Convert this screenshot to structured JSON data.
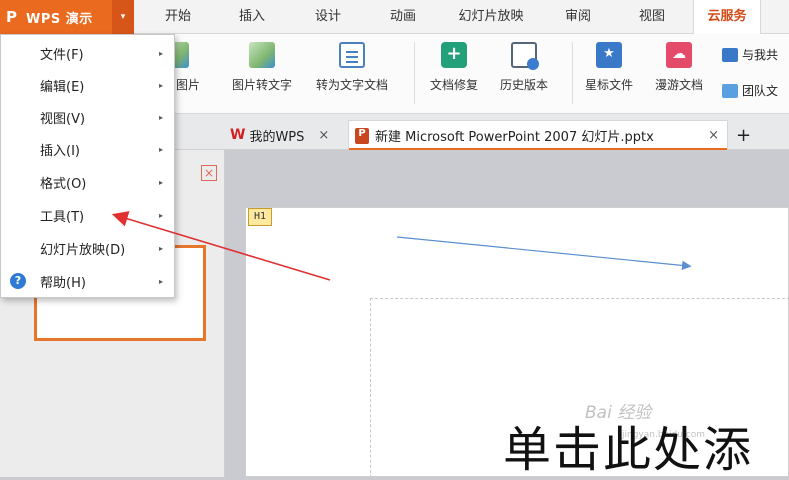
{
  "app": {
    "logo": "P",
    "name": "WPS 演示",
    "dropdown_glyph": "▾"
  },
  "tabs": [
    {
      "label": "开始"
    },
    {
      "label": "插入"
    },
    {
      "label": "设计"
    },
    {
      "label": "动画"
    },
    {
      "label": "幻灯片放映"
    },
    {
      "label": "审阅"
    },
    {
      "label": "视图"
    },
    {
      "label": "云服务",
      "active": true
    }
  ],
  "ribbon": {
    "buttons": [
      {
        "label": "转为图片",
        "icon": "image-icon"
      },
      {
        "label": "图片转文字",
        "icon": "image-to-text-icon"
      },
      {
        "label": "转为文字文档",
        "icon": "convert-doc-icon"
      },
      {
        "label": "文档修复",
        "icon": "document-repair-icon"
      },
      {
        "label": "历史版本",
        "icon": "history-version-icon"
      },
      {
        "label": "星标文件",
        "icon": "star-file-icon"
      },
      {
        "label": "漫游文档",
        "icon": "roaming-doc-icon"
      }
    ],
    "small_buttons": [
      {
        "label": "与我共",
        "icon": "share-with-me-icon"
      },
      {
        "label": "团队文",
        "icon": "team-doc-icon"
      }
    ]
  },
  "doc_tabs": {
    "wps_tab": {
      "logo": "W",
      "label": "我的WPS",
      "close": "×"
    },
    "file_tab": {
      "label": "新建 Microsoft PowerPoint 2007 幻灯片.pptx",
      "close": "×"
    },
    "add": "+"
  },
  "menu": {
    "items": [
      {
        "label": "文件(F)"
      },
      {
        "label": "编辑(E)"
      },
      {
        "label": "视图(V)"
      },
      {
        "label": "插入(I)"
      },
      {
        "label": "格式(O)"
      },
      {
        "label": "工具(T)"
      },
      {
        "label": "幻灯片放映(D)"
      },
      {
        "label": "帮助(H)"
      }
    ],
    "arrow": "▸",
    "help_icon": "?"
  },
  "slide": {
    "tag": "H1",
    "title": "单击此处添",
    "watermark": "Bai 经验",
    "watermark_url": "jingyan.baidu.com"
  },
  "panel": {
    "close": "×"
  },
  "colors": {
    "accent": "#ea6a1f",
    "annotation_arrow": "#e03030",
    "blue_arrow": "#5b8fd0"
  }
}
